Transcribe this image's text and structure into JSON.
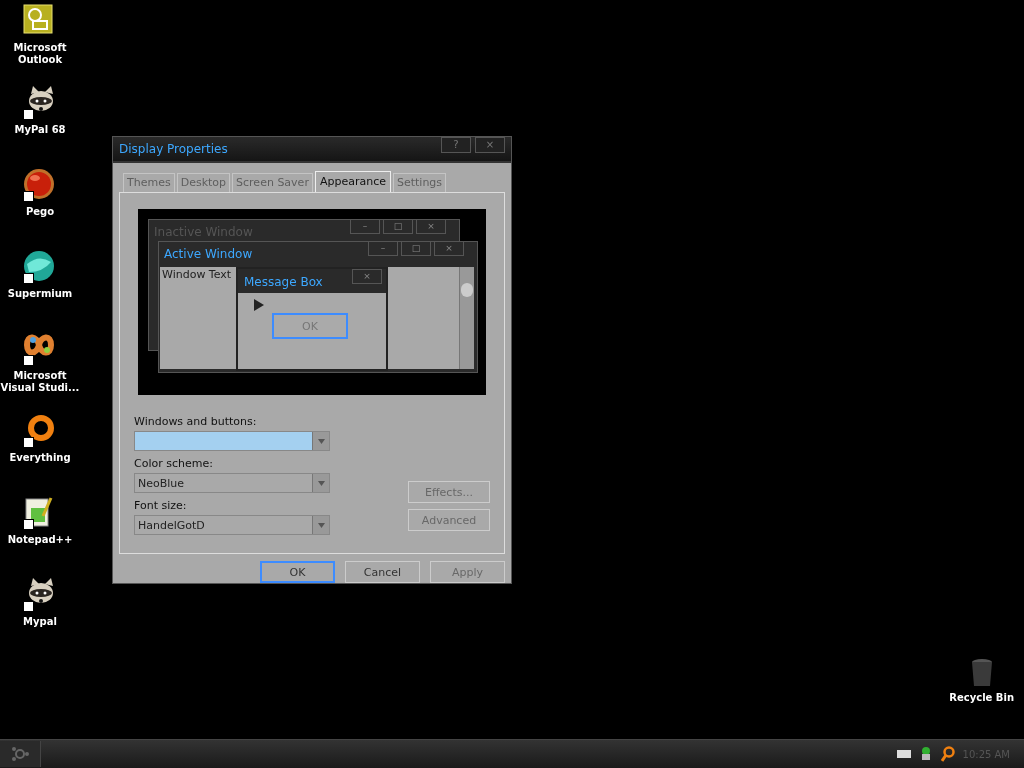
{
  "desktop_icons": [
    {
      "label": "Microsoft Outlook",
      "kind": "outlook",
      "shortcut": false
    },
    {
      "label": "MyPal 68",
      "kind": "raccoon",
      "shortcut": true
    },
    {
      "label": "Pego",
      "kind": "pego",
      "shortcut": true
    },
    {
      "label": "Supermium",
      "kind": "supermium",
      "shortcut": true
    },
    {
      "label": "Microsoft Visual Studi...",
      "kind": "vs",
      "shortcut": true
    },
    {
      "label": "Everything",
      "kind": "everything",
      "shortcut": true
    },
    {
      "label": "Notepad++",
      "kind": "notepad",
      "shortcut": true
    },
    {
      "label": "Mypal",
      "kind": "raccoon",
      "shortcut": true
    }
  ],
  "recycle_bin": {
    "label": "Recycle Bin"
  },
  "window": {
    "title": "Display Properties",
    "title_buttons": [
      "?",
      "×"
    ],
    "tabs": [
      {
        "label": "Themes",
        "selected": false
      },
      {
        "label": "Desktop",
        "selected": false
      },
      {
        "label": "Screen Saver",
        "selected": false
      },
      {
        "label": "Appearance",
        "selected": true
      },
      {
        "label": "Settings",
        "selected": false
      }
    ],
    "preview": {
      "inactive_title": "Inactive Window",
      "active_title": "Active Window",
      "window_text": "Window Text",
      "message_title": "Message Box",
      "message_button": "OK",
      "caption_buttons": [
        "–",
        "□",
        "×"
      ],
      "close_button": "×"
    },
    "fields": [
      {
        "label": "Windows and buttons:",
        "highlighted": true
      },
      {
        "label": "Color scheme:",
        "value": "NeoBlue",
        "highlighted": false
      },
      {
        "label": "Font size:",
        "value": "HandelGotD",
        "highlighted": false
      }
    ],
    "side_buttons": [
      {
        "label": "Effects...",
        "disabled": true
      },
      {
        "label": "Advanced",
        "disabled": true
      }
    ],
    "buttons": [
      {
        "label": "OK",
        "default": true,
        "disabled": false
      },
      {
        "label": "Cancel",
        "default": false,
        "disabled": false
      },
      {
        "label": "Apply",
        "default": false,
        "disabled": true
      }
    ]
  },
  "taskbar": {
    "clock": "10:25 AM"
  }
}
